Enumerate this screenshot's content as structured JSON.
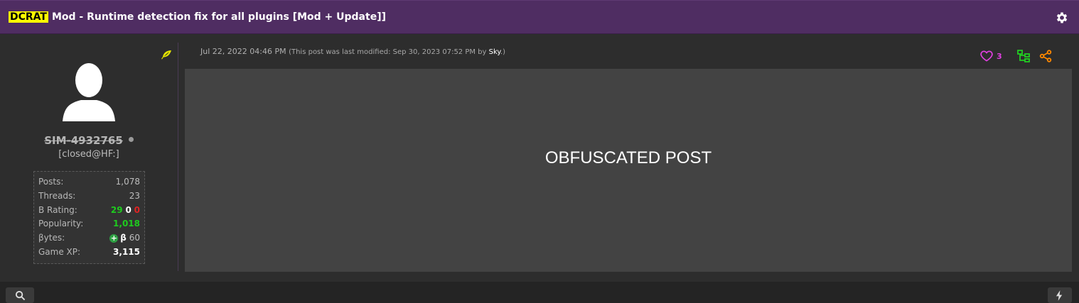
{
  "thread": {
    "tag": "DCRAT",
    "title": "Mod - Runtime detection fix for all plugins [Mod + Update]]"
  },
  "author": {
    "username": "SIM-4932765",
    "user_title": "[closed@HF:]",
    "stats": [
      {
        "label": "Posts:",
        "value": "1,078"
      },
      {
        "label": "Threads:",
        "value": "23"
      },
      {
        "label": "B Rating:",
        "positive": "29",
        "neutral": "0",
        "negative": "0"
      },
      {
        "label": "Popularity:",
        "value": "1,018"
      },
      {
        "label": "βytes:",
        "beta": "β",
        "value": "60"
      },
      {
        "label": "Game XP:",
        "value": "3,115"
      }
    ]
  },
  "post": {
    "date": "Jul 22, 2022 04:46 PM",
    "modified_prefix": "(This post was last modified: Sep 30, 2023 07:52 PM by",
    "modified_by": "Sky",
    "modified_suffix": ".)",
    "likes": "3",
    "body": "OBFUSCATED POST"
  },
  "icons": {
    "settings": "gear-icon",
    "rank": "feather-icon",
    "like": "heart-icon",
    "thread_tree": "tree-icon",
    "share": "share-icon",
    "search": "search-icon",
    "quick": "bolt-icon"
  },
  "colors": {
    "header_bg": "#4f2d62",
    "tag_bg": "#ffff00",
    "positive": "#1ecb1e",
    "negative": "#e02424",
    "like": "#e040e0",
    "tree": "#22cc22",
    "share": "#ff8800"
  }
}
